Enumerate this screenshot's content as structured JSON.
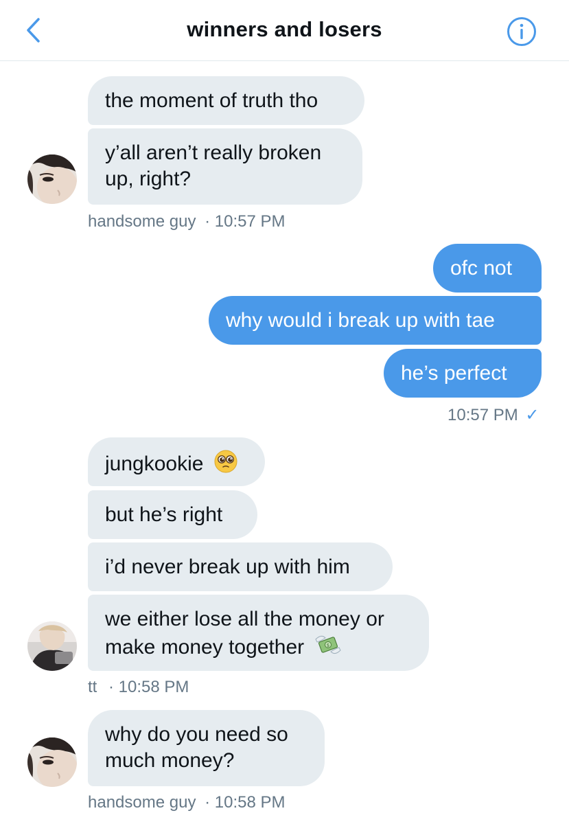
{
  "header": {
    "title": "winners and losers",
    "back_icon": "chevron-left-icon",
    "info_icon": "info-icon",
    "accent": "#4a99e9"
  },
  "messages": [
    {
      "text": "the moment of truth tho"
    },
    {
      "lines": [
        "y’all aren’t really broken",
        "up, right?"
      ]
    },
    {
      "meta": {
        "sender": "handsome guy",
        "time": "· 10:57 PM"
      }
    },
    {
      "text": "ofc not"
    },
    {
      "text": "why would i break up with tae"
    },
    {
      "text": "he’s perfect"
    },
    {
      "meta": {
        "time": "10:57 PM",
        "status": "✓"
      }
    },
    {
      "text": "jungkookie",
      "emoji": "pleading-face-emoji"
    },
    {
      "text": "but he’s right"
    },
    {
      "text": "i’d never break up with him"
    },
    {
      "lines": [
        "we either lose all the money or",
        "make money together"
      ],
      "emoji": "money-with-wings-emoji"
    },
    {
      "meta": {
        "sender": "tt",
        "time": "· 10:58 PM"
      }
    },
    {
      "lines": [
        "why do you need so",
        "much money?"
      ]
    },
    {
      "meta": {
        "sender": "handsome guy",
        "time": "· 10:58 PM"
      }
    }
  ],
  "colors": {
    "incoming_bubble": "#e6ecf0",
    "outgoing_bubble": "#4a99e9",
    "meta_text": "#657786"
  }
}
